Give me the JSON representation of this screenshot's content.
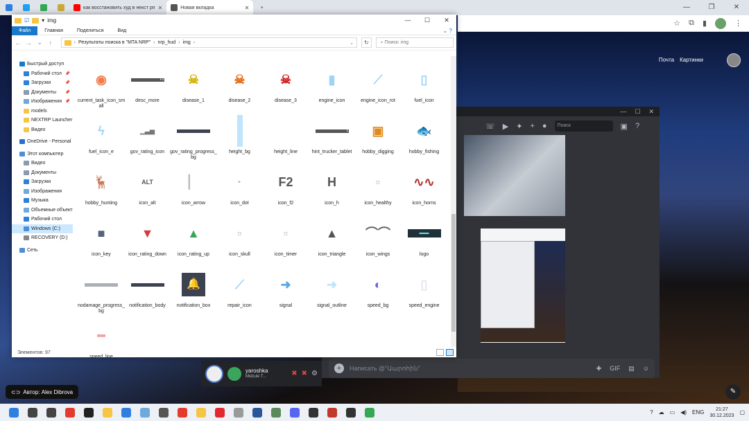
{
  "browser": {
    "tabs": [
      {
        "label": "",
        "color": "#2f7fe0",
        "narrow": true
      },
      {
        "label": "",
        "color": "#1da1f2",
        "narrow": true
      },
      {
        "label": "",
        "color": "#34a853",
        "narrow": true
      },
      {
        "label": "",
        "color": "#c9a93a",
        "narrow": true
      },
      {
        "label": "как восстановить худ в некст рп",
        "color": "#ff0000",
        "narrow": false
      },
      {
        "label": "Новая вкладка",
        "color": "#555555",
        "narrow": false,
        "active": true
      }
    ],
    "new_tab": "+",
    "links": [
      "Почта",
      "Картинки"
    ]
  },
  "explorer": {
    "title": "img",
    "ribbon": [
      "Файл",
      "Главная",
      "Поделиться",
      "Вид"
    ],
    "path": [
      "Результаты поиска в \"MTA NRP\"",
      "nrp_hud",
      "img"
    ],
    "search_placeholder": "Поиск: img",
    "status": "Элементов: 97",
    "sidebar": [
      {
        "label": "Быстрый доступ",
        "top": true,
        "color": "#1979ca"
      },
      {
        "label": "Рабочий стол",
        "color": "#2f80d8",
        "pin": true
      },
      {
        "label": "Загрузки",
        "color": "#2f80d8",
        "pin": true
      },
      {
        "label": "Документы",
        "color": "#8a9bb0",
        "pin": true
      },
      {
        "label": "Изображения",
        "color": "#6fa8dc",
        "pin": true
      },
      {
        "label": "models",
        "color": "#f7c544"
      },
      {
        "label": "NEXTRP Launcher",
        "color": "#f7c544"
      },
      {
        "label": "Видео",
        "color": "#f7c544"
      },
      {
        "label": "OneDrive - Personal",
        "top": true,
        "color": "#2a6fc9"
      },
      {
        "label": "Этот компьютер",
        "top": true,
        "color": "#4a8fd8"
      },
      {
        "label": "Видео",
        "color": "#8a9bb0"
      },
      {
        "label": "Документы",
        "color": "#8a9bb0"
      },
      {
        "label": "Загрузки",
        "color": "#2f80d8"
      },
      {
        "label": "Изображения",
        "color": "#6fa8dc"
      },
      {
        "label": "Музыка",
        "color": "#2f80d8"
      },
      {
        "label": "Объемные объекты",
        "color": "#6fa8dc"
      },
      {
        "label": "Рабочий стол",
        "color": "#2f80d8"
      },
      {
        "label": "Windows (C:)",
        "color": "#4a8fd8",
        "sel": true
      },
      {
        "label": "RECOVERY (D:)",
        "color": "#888888"
      },
      {
        "label": "Сеть",
        "top": true,
        "color": "#4a8fd8"
      }
    ],
    "files": [
      {
        "name": "current_task_icon_small",
        "glyph": "◉",
        "color": "#f47c48"
      },
      {
        "name": "desc_more",
        "glyph": "F2",
        "color": "#555555",
        "kind": "bar"
      },
      {
        "name": "disease_1",
        "glyph": "☠",
        "color": "#d6b200"
      },
      {
        "name": "disease_2",
        "glyph": "☠",
        "color": "#e46a10"
      },
      {
        "name": "disease_3",
        "glyph": "☠",
        "color": "#d21f1f"
      },
      {
        "name": "engine_icon",
        "glyph": "▮",
        "color": "#9fd3f5"
      },
      {
        "name": "engine_icon_rot",
        "glyph": "⟋",
        "color": "#9fd3f5"
      },
      {
        "name": "fuel_icon",
        "glyph": "▯",
        "color": "#9fd3f5"
      },
      {
        "name": "fuel_icon_e",
        "glyph": "ϟ",
        "color": "#9fd3f5"
      },
      {
        "name": "gov_rating_icon",
        "glyph": "▁▃▅",
        "color": "#777777"
      },
      {
        "name": "gov_rating_progress_bg",
        "glyph": "",
        "color": "#3c4250",
        "kind": "bar"
      },
      {
        "name": "height_bg",
        "glyph": "▮",
        "color": "#bfe4fb",
        "kind": "tall"
      },
      {
        "name": "height_line",
        "glyph": "",
        "color": "#cccccc"
      },
      {
        "name": "hint_trucker_tablet",
        "glyph": "L",
        "color": "#555555",
        "kind": "bar"
      },
      {
        "name": "hobby_digging",
        "glyph": "▣",
        "color": "#e08a1e"
      },
      {
        "name": "hobby_fishing",
        "glyph": "🐟",
        "color": "#6b7f8f"
      },
      {
        "name": "hobby_hunting",
        "glyph": "🦌",
        "color": "#8a5a2e"
      },
      {
        "name": "icon_alt",
        "glyph": "ALT",
        "color": "#555555"
      },
      {
        "name": "icon_arrow",
        "glyph": "▏",
        "color": "#bbbbbb"
      },
      {
        "name": "icon_dot",
        "glyph": "·",
        "color": "#bbbbbb"
      },
      {
        "name": "icon_f2",
        "glyph": "F2",
        "color": "#555555"
      },
      {
        "name": "icon_h",
        "glyph": "H",
        "color": "#555555"
      },
      {
        "name": "icon_healthy",
        "glyph": "▫",
        "color": "#bbbbbb"
      },
      {
        "name": "icon_horns",
        "glyph": "∿∿",
        "color": "#b03030"
      },
      {
        "name": "icon_key",
        "glyph": "■",
        "color": "#54637a"
      },
      {
        "name": "icon_rating_down",
        "glyph": "▼",
        "color": "#d23b3b"
      },
      {
        "name": "icon_rating_up",
        "glyph": "▲",
        "color": "#3aa55a"
      },
      {
        "name": "icon_skull",
        "glyph": "▫",
        "color": "#bbbbbb"
      },
      {
        "name": "icon_timer",
        "glyph": "▫",
        "color": "#bbbbbb"
      },
      {
        "name": "icon_triangle",
        "glyph": "▲",
        "color": "#555555"
      },
      {
        "name": "icon_wings",
        "glyph": "⌒⌒",
        "color": "#666666"
      },
      {
        "name": "logo",
        "glyph": "▬▬",
        "color": "#20303a",
        "kind": "logo"
      },
      {
        "name": "nodamage_progress_bg",
        "glyph": "",
        "color": "#aab0b6",
        "kind": "bar"
      },
      {
        "name": "notification_body",
        "glyph": "",
        "color": "#3c4250",
        "kind": "bar"
      },
      {
        "name": "notification_box",
        "glyph": "🔔",
        "color": "#3c4250",
        "kind": "dark"
      },
      {
        "name": "repair_icon",
        "glyph": "⟋",
        "color": "#9fd3f5"
      },
      {
        "name": "signal",
        "glyph": "➜",
        "color": "#5aa6e6"
      },
      {
        "name": "signal_outline",
        "glyph": "➜",
        "color": "#bfe4fb"
      },
      {
        "name": "speed_bg",
        "glyph": "◐",
        "color": "#6a6ad8"
      },
      {
        "name": "speed_engine",
        "glyph": "▯",
        "color": "#dde6ee"
      },
      {
        "name": "speed_line",
        "glyph": "━",
        "color": "#f2a0a0"
      }
    ]
  },
  "discord": {
    "search_placeholder": "Поиск",
    "input_placeholder": "Написать @\"Աարոհին\"",
    "username": "yaroshka",
    "subtitle": "Midzuki T..."
  },
  "desktop": {
    "attribution": "Автор: Alex Dibrova"
  },
  "taskbar": {
    "lang": "ENG",
    "time": "21:27",
    "date": "30.12.2023",
    "apps": [
      {
        "name": "start",
        "color": "#2f7fe0"
      },
      {
        "name": "search",
        "color": "#444444"
      },
      {
        "name": "taskview",
        "color": "#444444"
      },
      {
        "name": "yandex",
        "color": "#e33b2e"
      },
      {
        "name": "amazon",
        "color": "#222222"
      },
      {
        "name": "explorer",
        "color": "#f7c544"
      },
      {
        "name": "dropbox",
        "color": "#2f7fe0"
      },
      {
        "name": "notepad",
        "color": "#6fa8dc"
      },
      {
        "name": "calculator",
        "color": "#555555"
      },
      {
        "name": "yandex-browser",
        "color": "#e33b2e"
      },
      {
        "name": "folder",
        "color": "#f7c544"
      },
      {
        "name": "opera",
        "color": "#e3272e"
      },
      {
        "name": "files",
        "color": "#9a9a9a"
      },
      {
        "name": "word",
        "color": "#2b579a"
      },
      {
        "name": "app",
        "color": "#5a8a5a"
      },
      {
        "name": "discord",
        "color": "#5865f2"
      },
      {
        "name": "obs",
        "color": "#333333"
      },
      {
        "name": "app2",
        "color": "#c0392b"
      },
      {
        "name": "app3",
        "color": "#333333"
      },
      {
        "name": "chrome",
        "color": "#34a853"
      }
    ]
  }
}
